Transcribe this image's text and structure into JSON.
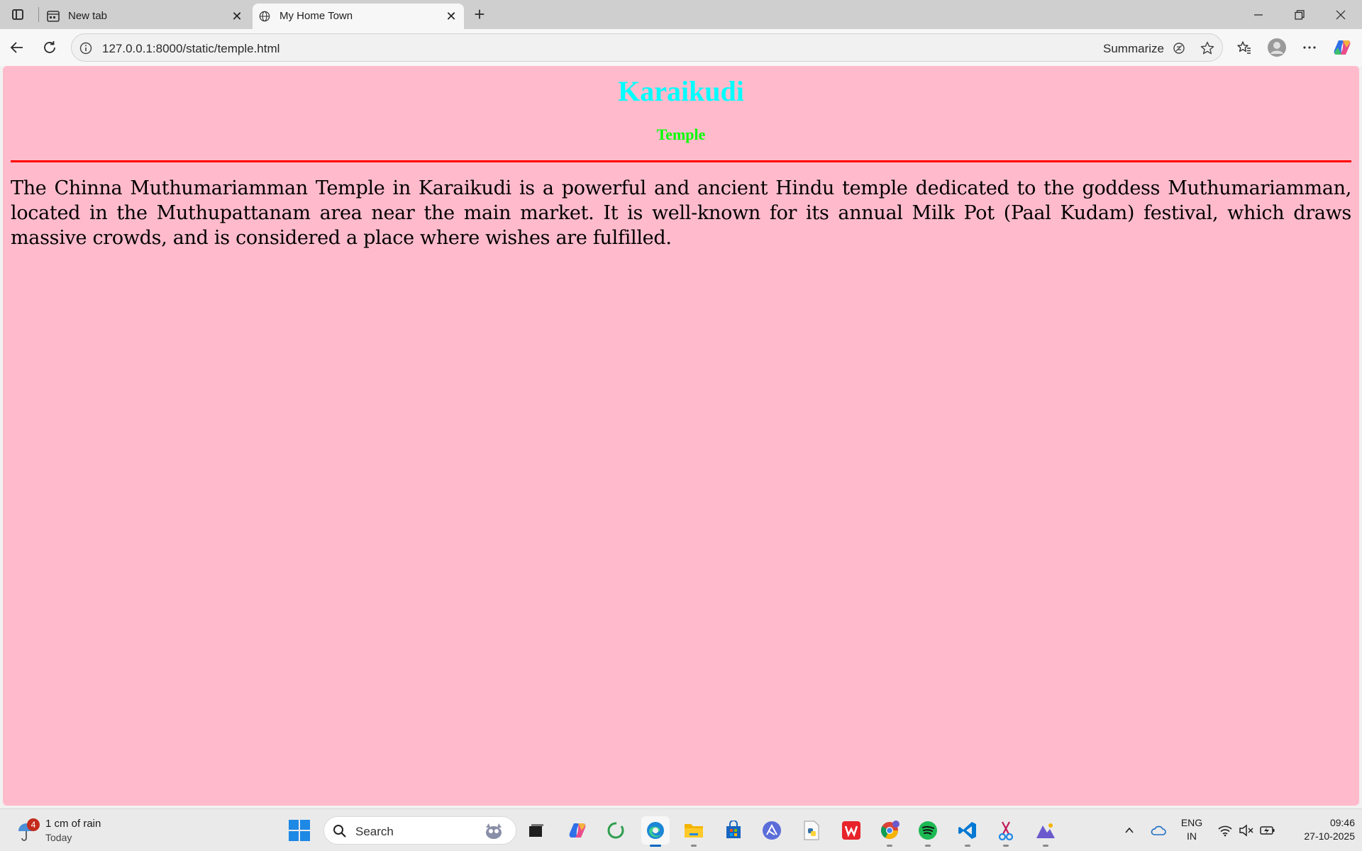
{
  "browser": {
    "tabs": [
      {
        "label": "New tab",
        "active": false
      },
      {
        "label": "My Home Town",
        "active": true
      }
    ],
    "url": "127.0.0.1:8000/static/temple.html",
    "summarize_label": "Summarize"
  },
  "page": {
    "background": "#ffbbcc",
    "heading": "Karaikudi",
    "heading_color": "#00ffff",
    "subheading": "Temple",
    "subheading_color": "#00ff00",
    "rule_color": "#ff0000",
    "paragraph": "The Chinna Muthumariamman Temple in Karaikudi is a powerful and ancient Hindu temple dedicated to the goddess Muthumariamman, located in the Muthupattanam area near the main market. It is well-known for its annual Milk Pot (Paal Kudam) festival, which draws massive crowds, and is considered a place where wishes are fulfilled."
  },
  "taskbar": {
    "weather": {
      "badge": "4",
      "text": "1 cm of rain",
      "sub": "Today"
    },
    "search_label": "Search",
    "apps": [
      "task-view",
      "copilot",
      "circle-app",
      "edge",
      "file-explorer",
      "microsoft-store",
      "affinity",
      "python-file",
      "wps-office",
      "chrome",
      "spotify",
      "vscode",
      "snipping-tool",
      "photos"
    ],
    "language": {
      "line1": "ENG",
      "line2": "IN"
    },
    "time": "09:46",
    "date": "27-10-2025"
  }
}
